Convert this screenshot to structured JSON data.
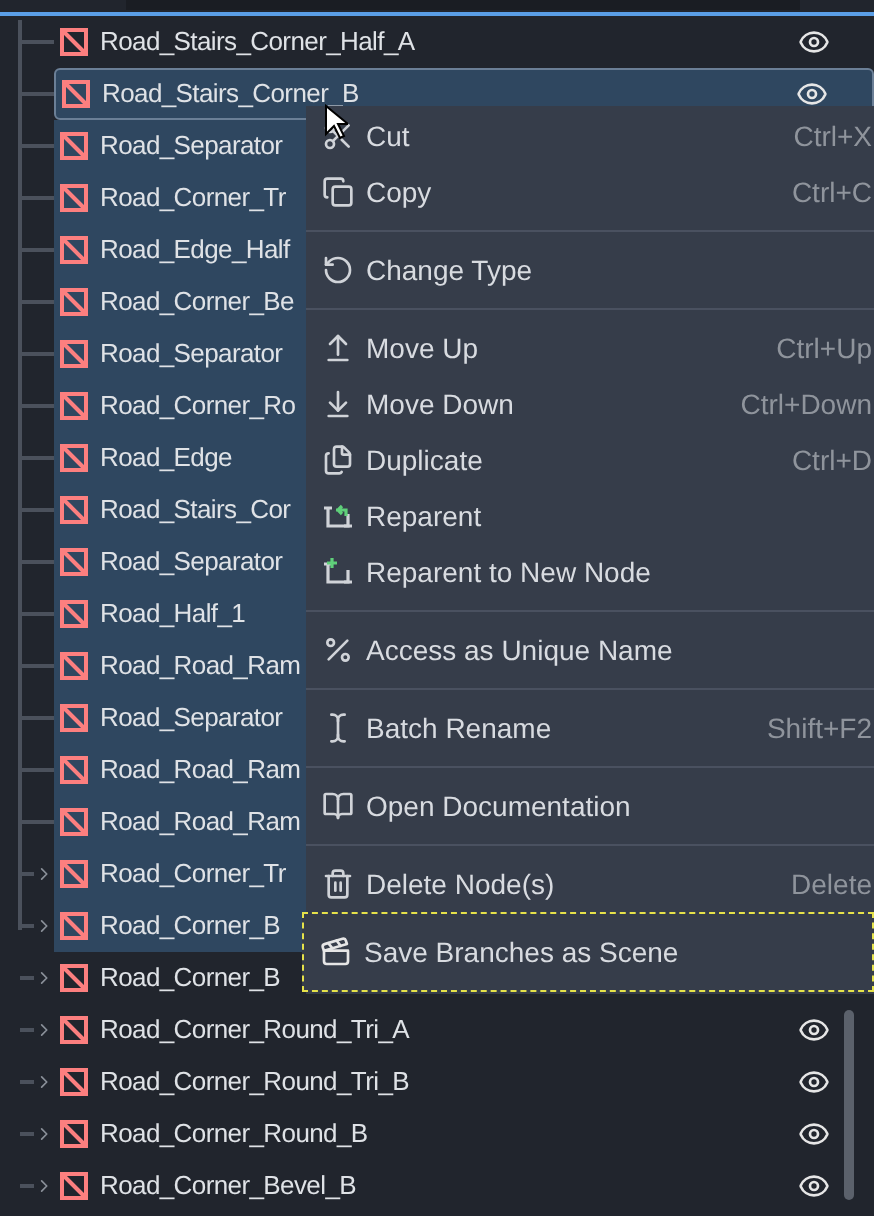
{
  "tree": {
    "rows": [
      {
        "name": "Road_Stairs_Corner_Half_A",
        "selected": false,
        "focused": false,
        "has_children": false,
        "eye_icon": true
      },
      {
        "name": "Road_Stairs_Corner_B",
        "selected": true,
        "focused": true,
        "has_children": false,
        "eye_icon": true
      },
      {
        "name": "Road_Separator",
        "selected": true,
        "focused": false,
        "has_children": false,
        "eye_icon": false
      },
      {
        "name": "Road_Corner_Tr",
        "selected": true,
        "focused": false,
        "has_children": false,
        "eye_icon": false
      },
      {
        "name": "Road_Edge_Half",
        "selected": true,
        "focused": false,
        "has_children": false,
        "eye_icon": false
      },
      {
        "name": "Road_Corner_Be",
        "selected": true,
        "focused": false,
        "has_children": false,
        "eye_icon": false
      },
      {
        "name": "Road_Separator",
        "selected": true,
        "focused": false,
        "has_children": false,
        "eye_icon": false
      },
      {
        "name": "Road_Corner_Ro",
        "selected": true,
        "focused": false,
        "has_children": false,
        "eye_icon": false
      },
      {
        "name": "Road_Edge",
        "selected": true,
        "focused": false,
        "has_children": false,
        "eye_icon": false
      },
      {
        "name": "Road_Stairs_Cor",
        "selected": true,
        "focused": false,
        "has_children": false,
        "eye_icon": false
      },
      {
        "name": "Road_Separator",
        "selected": true,
        "focused": false,
        "has_children": false,
        "eye_icon": false
      },
      {
        "name": "Road_Half_1",
        "selected": true,
        "focused": false,
        "has_children": false,
        "eye_icon": false
      },
      {
        "name": "Road_Road_Ram",
        "selected": true,
        "focused": false,
        "has_children": false,
        "eye_icon": false
      },
      {
        "name": "Road_Separator",
        "selected": true,
        "focused": false,
        "has_children": false,
        "eye_icon": false
      },
      {
        "name": "Road_Road_Ram",
        "selected": true,
        "focused": false,
        "has_children": false,
        "eye_icon": false
      },
      {
        "name": "Road_Road_Ram",
        "selected": true,
        "focused": false,
        "has_children": false,
        "eye_icon": false
      },
      {
        "name": "Road_Corner_Tr",
        "selected": true,
        "focused": false,
        "has_children": true,
        "eye_icon": false
      },
      {
        "name": "Road_Corner_B",
        "selected": true,
        "focused": false,
        "has_children": true,
        "eye_icon": false
      },
      {
        "name": "Road_Corner_B",
        "selected": false,
        "focused": false,
        "has_children": true,
        "eye_icon": false
      },
      {
        "name": "Road_Corner_Round_Tri_A",
        "selected": false,
        "focused": false,
        "has_children": true,
        "eye_icon": true
      },
      {
        "name": "Road_Corner_Round_Tri_B",
        "selected": false,
        "focused": false,
        "has_children": true,
        "eye_icon": true
      },
      {
        "name": "Road_Corner_Round_B",
        "selected": false,
        "focused": false,
        "has_children": true,
        "eye_icon": true
      },
      {
        "name": "Road_Corner_Bevel_B",
        "selected": false,
        "focused": false,
        "has_children": true,
        "eye_icon": true
      }
    ]
  },
  "context_menu": {
    "items": [
      {
        "kind": "item",
        "label": "Cut",
        "shortcut": "Ctrl+X",
        "highlighted": false
      },
      {
        "kind": "item",
        "label": "Copy",
        "shortcut": "Ctrl+C",
        "highlighted": false
      },
      {
        "kind": "separator"
      },
      {
        "kind": "item",
        "label": "Change Type",
        "highlighted": false
      },
      {
        "kind": "separator"
      },
      {
        "kind": "item",
        "label": "Move Up",
        "shortcut": "Ctrl+Up",
        "highlighted": false
      },
      {
        "kind": "item",
        "label": "Move Down",
        "shortcut": "Ctrl+Down",
        "highlighted": false
      },
      {
        "kind": "item",
        "label": "Duplicate",
        "shortcut": "Ctrl+D",
        "highlighted": false
      },
      {
        "kind": "item",
        "label": "Reparent",
        "highlighted": false
      },
      {
        "kind": "item",
        "label": "Reparent to New Node",
        "highlighted": false
      },
      {
        "kind": "separator"
      },
      {
        "kind": "item",
        "label": "Access as Unique Name",
        "highlighted": false
      },
      {
        "kind": "separator"
      },
      {
        "kind": "item",
        "label": "Batch Rename",
        "shortcut": "Shift+F2",
        "highlighted": false
      },
      {
        "kind": "separator"
      },
      {
        "kind": "item",
        "label": "Open Documentation",
        "highlighted": false
      },
      {
        "kind": "separator"
      },
      {
        "kind": "item",
        "label": "Delete Node(s)",
        "shortcut": "Delete",
        "highlighted": false
      },
      {
        "kind": "item",
        "label": "Save Branches as Scene",
        "highlighted": true
      }
    ]
  }
}
